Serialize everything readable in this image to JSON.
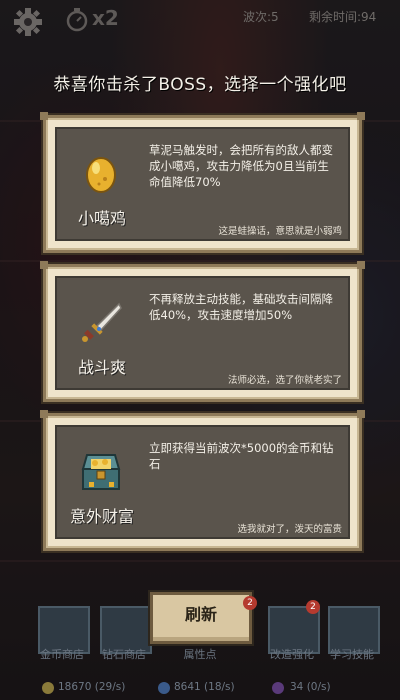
{
  "hud": {
    "speed": "x2",
    "wave": "波次:5",
    "time_left": "剩余时间:94"
  },
  "title": "恭喜你击杀了BOSS，选择一个强化吧",
  "cards": [
    {
      "name": "小噶鸡",
      "icon": "golden-egg-icon",
      "description": "草泥马触发时，会把所有的敌人都变成小噶鸡，攻击力降低为0且当前生命值降低70%",
      "note": "这是蛙操话，意思就是小弱鸡"
    },
    {
      "name": "战斗爽",
      "icon": "sword-icon",
      "description": "不再释放主动技能，基础攻击间隔降低40%，攻击速度增加50%",
      "note": "法师必选，选了你就老实了"
    },
    {
      "name": "意外财富",
      "icon": "treasure-chest-icon",
      "description": "立即获得当前波次*5000的金币和钻石",
      "note": "选我就对了，泼天的富贵"
    }
  ],
  "refresh_label": "刷新",
  "bottom": {
    "shops": [
      {
        "label": "金币商店"
      },
      {
        "label": "钻石商店"
      },
      {
        "label": "属性点"
      },
      {
        "label": "改造强化"
      },
      {
        "label": "学习技能"
      }
    ],
    "badges": [
      "2",
      "2"
    ]
  },
  "resources": {
    "gold": "18670 (29/s)",
    "diamond": "8641 (18/s)",
    "third": "34 (0/s)"
  },
  "colors": {
    "card_frame": "#8e7a59",
    "card_bg": "#5a544c",
    "refresh_bg": "#d9c7a2"
  }
}
